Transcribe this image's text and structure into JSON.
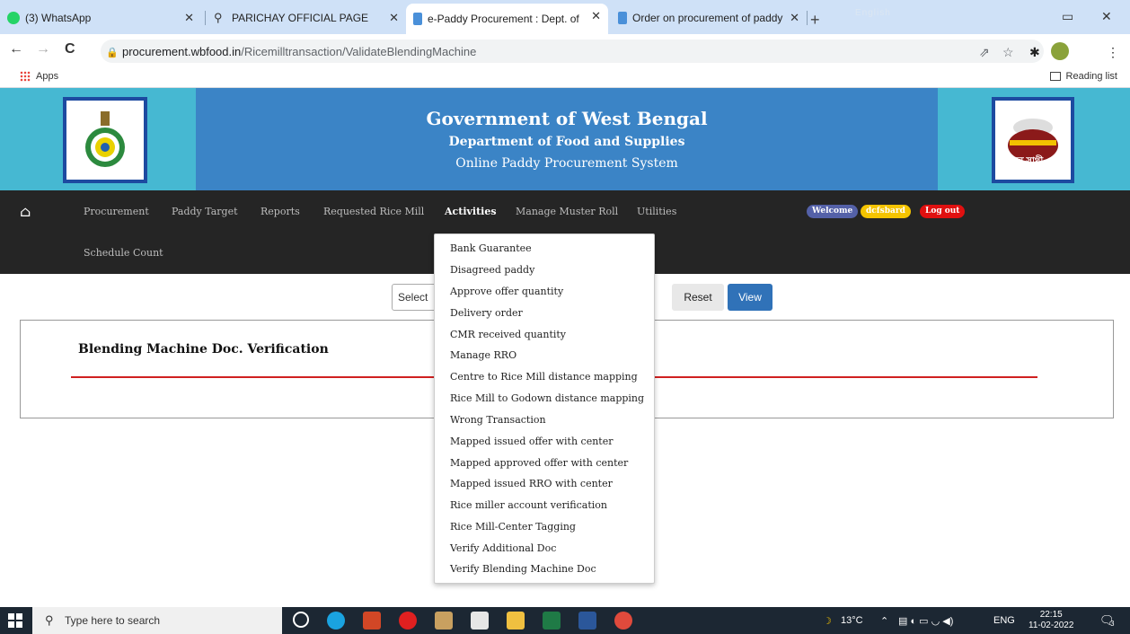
{
  "browser": {
    "tabs": [
      {
        "label": "(3) WhatsApp",
        "active": false
      },
      {
        "label": "PARICHAY OFFICIAL PAGE",
        "active": false
      },
      {
        "label": "e-Paddy Procurement : Dept. of F",
        "active": true
      },
      {
        "label": "Order on procurement of paddy",
        "active": false
      }
    ],
    "url_domain": "procurement.wbfood.in",
    "url_path": "/Ricemilltransaction/ValidateBlendingMachine",
    "bookmarks": {
      "apps": "Apps",
      "reading_list": "Reading list"
    },
    "tab_overlay_text": "English"
  },
  "banner": {
    "title": "Government of West Bengal",
    "dept": "Department of Food and Supplies",
    "system": "Online Paddy Procurement System",
    "logo_right_text": "খাদ্য সাথী"
  },
  "nav": {
    "items": [
      "Procurement",
      "Paddy Target",
      "Reports",
      "Requested Rice Mill",
      "Activities",
      "Manage Muster Roll",
      "Utilities"
    ],
    "second_row": "Schedule Count",
    "welcome": "Welcome",
    "user": "dcfsbard",
    "logout": "Log out",
    "colors": {
      "welcome": "#5461a8",
      "user": "#f5c400",
      "logout": "#e01010"
    }
  },
  "page": {
    "select_placeholder": "Select",
    "reset": "Reset",
    "view": "View",
    "panel_title": "Blending Machine Doc. Verification"
  },
  "dropdown": {
    "items": [
      "Bank Guarantee",
      "Disagreed paddy",
      "Approve offer quantity",
      "Delivery order",
      "CMR received quantity",
      "Manage RRO",
      "Centre to Rice Mill distance mapping",
      "Rice Mill to Godown distance mapping",
      "Wrong Transaction",
      "Mapped issued offer with center",
      "Mapped approved offer with center",
      "Mapped issued RRO with center",
      "Rice miller account verification",
      "Rice Mill-Center Tagging",
      "Verify Additional Doc",
      "Verify Blending Machine Doc"
    ]
  },
  "taskbar": {
    "search_placeholder": "Type here to search",
    "weather": "13°C",
    "lang": "ENG",
    "time": "22:15",
    "date": "11-02-2022",
    "notification_count": "3"
  }
}
